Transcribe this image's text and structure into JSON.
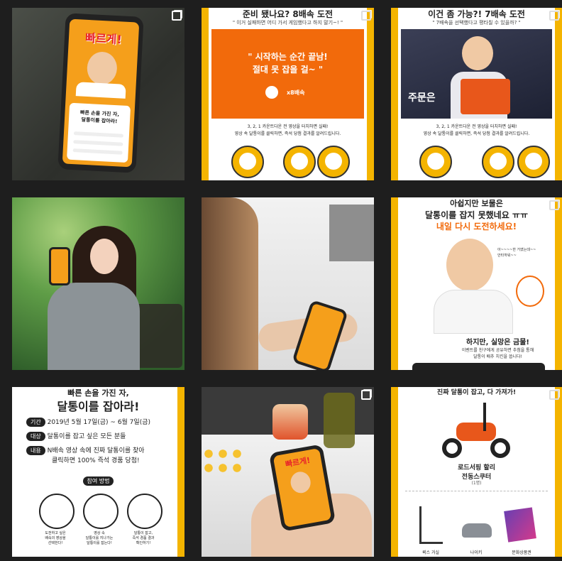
{
  "tiles": {
    "t1": {
      "phone_title": "빠르게!",
      "phone_caption": "빠른 손을 가진 자,\n달통이를 잡아라!"
    },
    "t2": {
      "headline": "준비 됐나요? 8배속 도전",
      "sub": "\" 이거 실패하면 어디 가서 게임했다고 하지 말기~! \"",
      "box_line1": "\" 시작하는 순간 끝남!",
      "box_line2": "절대 못 잡을 걸~ \"",
      "speed": "x8배속",
      "note1": "3, 2, 1 카운트다운 전 영상을 터치하면 실패!",
      "note2": "영상 속 달통이를 클릭하면, 즉석 당첨 결과를 알려드립니다."
    },
    "t3": {
      "headline": "이건 좀 가능?! 7배속 도전",
      "sub": "\" 7배속을 선택했다고 평타칠 수 있을까? \"",
      "video_word": "주문은",
      "note1": "3, 2, 1 카운트다운 전 영상을 터치하면 실패!",
      "note2": "영상 속 달통이를 클릭하면, 즉석 당첨 결과를 알려드립니다."
    },
    "t6": {
      "top": "아쉽지만 보물은",
      "line1": "달통이를 잡지 못했네요 ㅠㅠ",
      "line2": "내일 다시 도전하세요!",
      "bubble": "아~~~~한 거였는데~~ 안타까워~~",
      "bottom1": "하지만, 실망은 금물!",
      "bottom2": "이벤트를 친구에게 공유하면 추첨을 통해",
      "bottom3": "달통이 배추 치킨을 쏩니다!"
    },
    "t7": {
      "title_top": "빠른 손을 가진 자,",
      "title": "달통이를 잡아라!",
      "rows": [
        {
          "tag": "기간",
          "text": "2019년 5월 17일(금) ~ 6월 7일(금)"
        },
        {
          "tag": "대상",
          "text": "달통이를 잡고 싶은 모든 분들"
        },
        {
          "tag": "내용",
          "text": "N배속 영상 속에 진짜 달통이를 찾아"
        },
        {
          "tag": "",
          "text": "클릭하면 100% 즉석 경품 당첨!"
        }
      ],
      "how": "참여 방법",
      "steps": [
        "도전하고 싶은\n배속의 영상을\n선택한다!",
        "영상 속\n달통이를 지나가는\n달통이를 잡는다!",
        "달통이 잡고,\n즉석 경품 결과\n확인하기!"
      ]
    },
    "t9": {
      "top": "진짜 달통이 잡고, 다 가져가!",
      "prize": "로드서핑 할리\n전동스쿠터",
      "prize_count": "(1명)",
      "items": [
        "퀵스 거실",
        "나이키",
        "문화상품권"
      ]
    }
  }
}
